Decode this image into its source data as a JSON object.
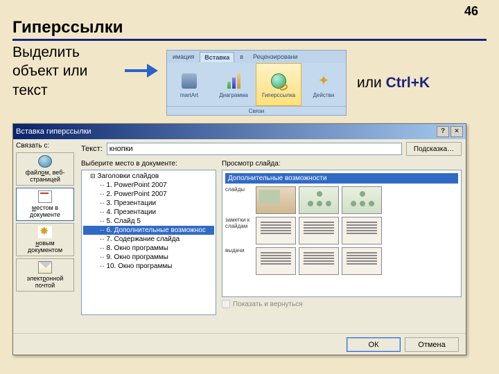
{
  "page_number": "46",
  "title": "Гиперссылки",
  "instruction": "Выделить\nобъект или\nтекст",
  "or_text": "или ",
  "shortcut": "Ctrl+K",
  "ribbon": {
    "tabs": [
      "имация",
      "Вставка",
      "в",
      "Рецензировани"
    ],
    "items": [
      "martArt",
      "Диаграмма",
      "Гиперссылка",
      "Действи"
    ],
    "group": "Связи"
  },
  "dialog": {
    "title": "Вставка гиперссылки",
    "help": "?",
    "close": "×",
    "link_label": "Связать с:",
    "text_label": "Текст:",
    "text_value": "кнопки",
    "hint_btn": "Подсказка…",
    "sidebar": [
      {
        "label": "файлом, веб-\nстраницей"
      },
      {
        "label": "местом в\nдокументе"
      },
      {
        "label": "новым\nдокументом"
      },
      {
        "label": "электронной\nпочтой"
      }
    ],
    "tree_label": "Выберите место в документе:",
    "tree": {
      "root": "Заголовки слайдов",
      "items": [
        "1. PowerPoint 2007",
        "2. PowerPoint 2007",
        "3. Презентации",
        "4. Презентации",
        "5. Слайд 5",
        "6. Дополнительные возможнос",
        "7. Содержание слайда",
        "8. Окно программы",
        "9. Окно программы",
        "10. Окно программы"
      ],
      "selected_index": 5
    },
    "preview_label": "Просмотр слайда:",
    "preview_title": "Дополнительные возможности",
    "pv_labels": {
      "slides": "слайды",
      "notes": "заметки к слайдам",
      "handouts": "выдачи"
    },
    "checkbox": "Показать и вернуться",
    "ok": "ОК",
    "cancel": "Отмена"
  }
}
